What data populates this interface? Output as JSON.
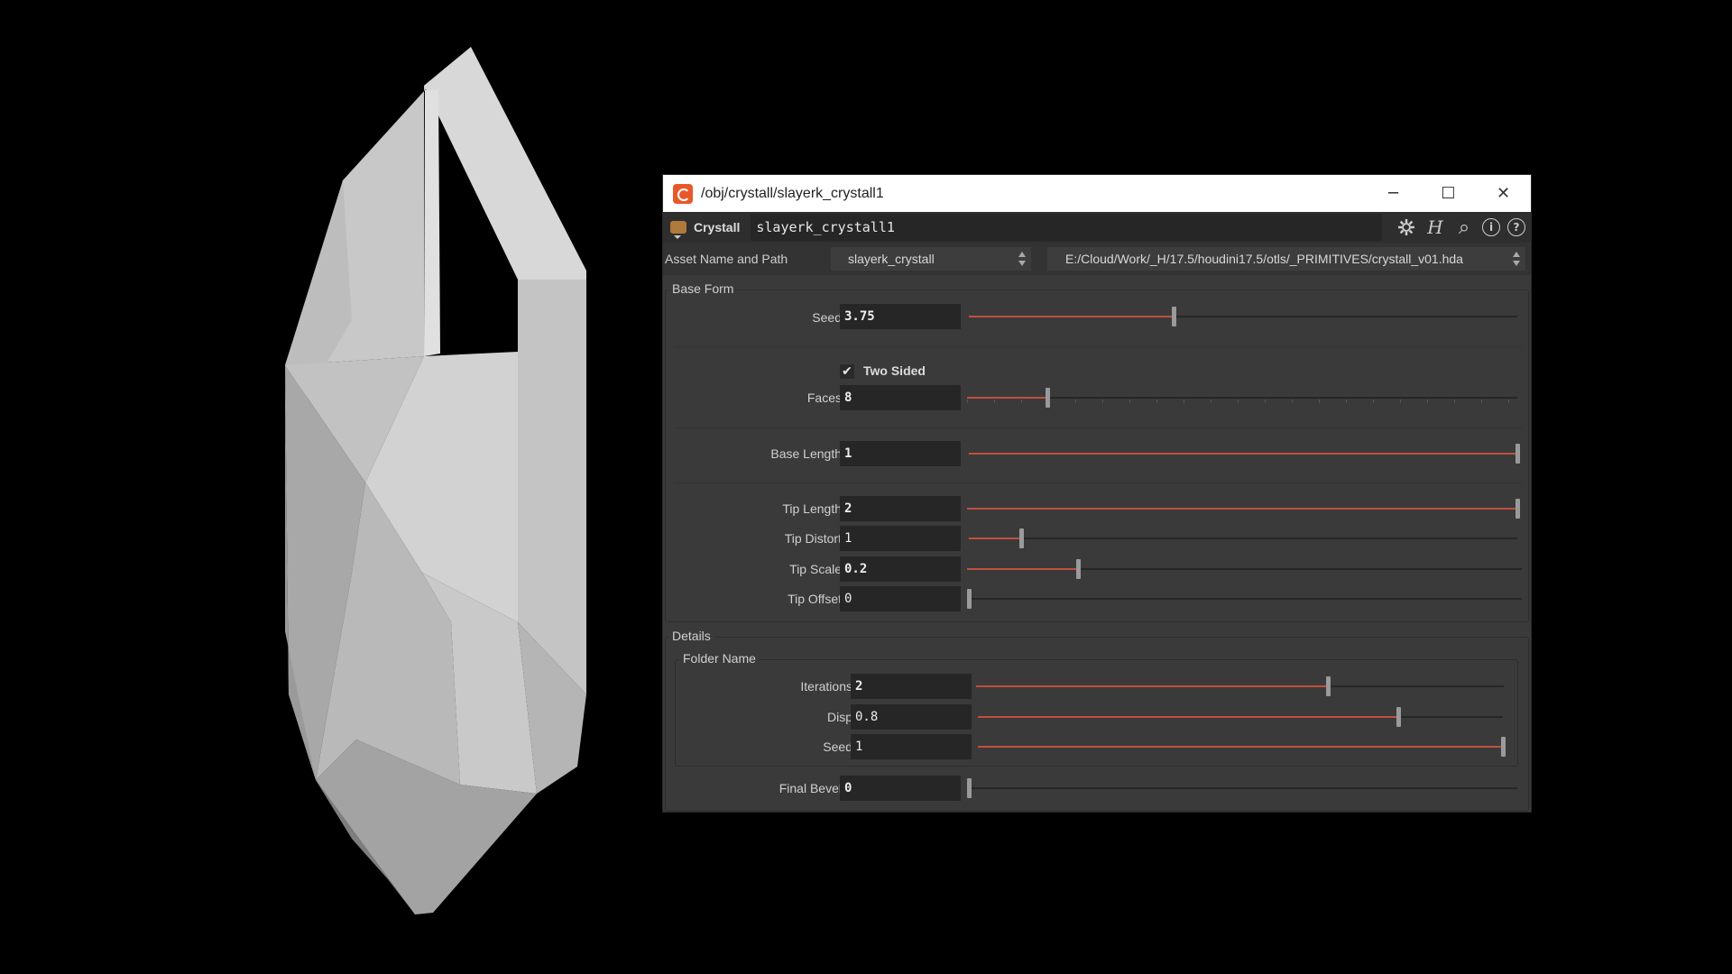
{
  "window": {
    "title": "/obj/crystall/slayerk_crystall1",
    "minimize_glyph": "─",
    "maximize_glyph": "☐",
    "close_glyph": "✕"
  },
  "toolbar": {
    "node_type": "Crystall",
    "node_name": "slayerk_crystall1",
    "icons": [
      "gear-icon",
      "hda-icon",
      "search-icon",
      "info-icon",
      "help-icon"
    ],
    "hda_glyph": "H",
    "search_glyph": "⌕",
    "info_glyph": "i",
    "help_glyph": "?"
  },
  "asset": {
    "label": "Asset Name and Path",
    "name": "slayerk_crystall",
    "path": "E:/Cloud/Work/_H/17.5/houdini17.5/otls/_PRIMITIVES/crystall_v01.hda"
  },
  "sections": {
    "base_form": "Base Form",
    "details": "Details",
    "folder": "Folder Name"
  },
  "params": {
    "seed": {
      "label": "Seed",
      "value": "3.75",
      "fraction": 0.373
    },
    "two_sided": {
      "label": "Two Sided",
      "checked": true,
      "glyph": "✔"
    },
    "faces": {
      "label": "Faces",
      "value": "8",
      "fraction": 0.146
    },
    "base_length": {
      "label": "Base Length",
      "value": "1",
      "fraction": 1.0
    },
    "tip_length": {
      "label": "Tip Length",
      "value": "2",
      "fraction": 1.0
    },
    "tip_distort": {
      "label": "Tip Distort",
      "value": "1",
      "fraction": 0.096
    },
    "tip_scale": {
      "label": "Tip Scale",
      "value": "0.2",
      "fraction": 0.2
    },
    "tip_offset": {
      "label": "Tip Offset",
      "value": "0",
      "fraction": 0.0
    },
    "iterations": {
      "label": "Iterations",
      "value": "2",
      "fraction": 0.667
    },
    "disp": {
      "label": "Disp",
      "value": "0.8",
      "fraction": 0.8
    },
    "seed2": {
      "label": "Seed",
      "value": "1",
      "fraction": 1.0
    },
    "final_bevel": {
      "label": "Final Bevel",
      "value": "0",
      "fraction": 0.0
    }
  },
  "colors": {
    "slider_fill": "#c0503e",
    "panel_bg": "#3a3a3a",
    "field_bg": "#262626"
  }
}
